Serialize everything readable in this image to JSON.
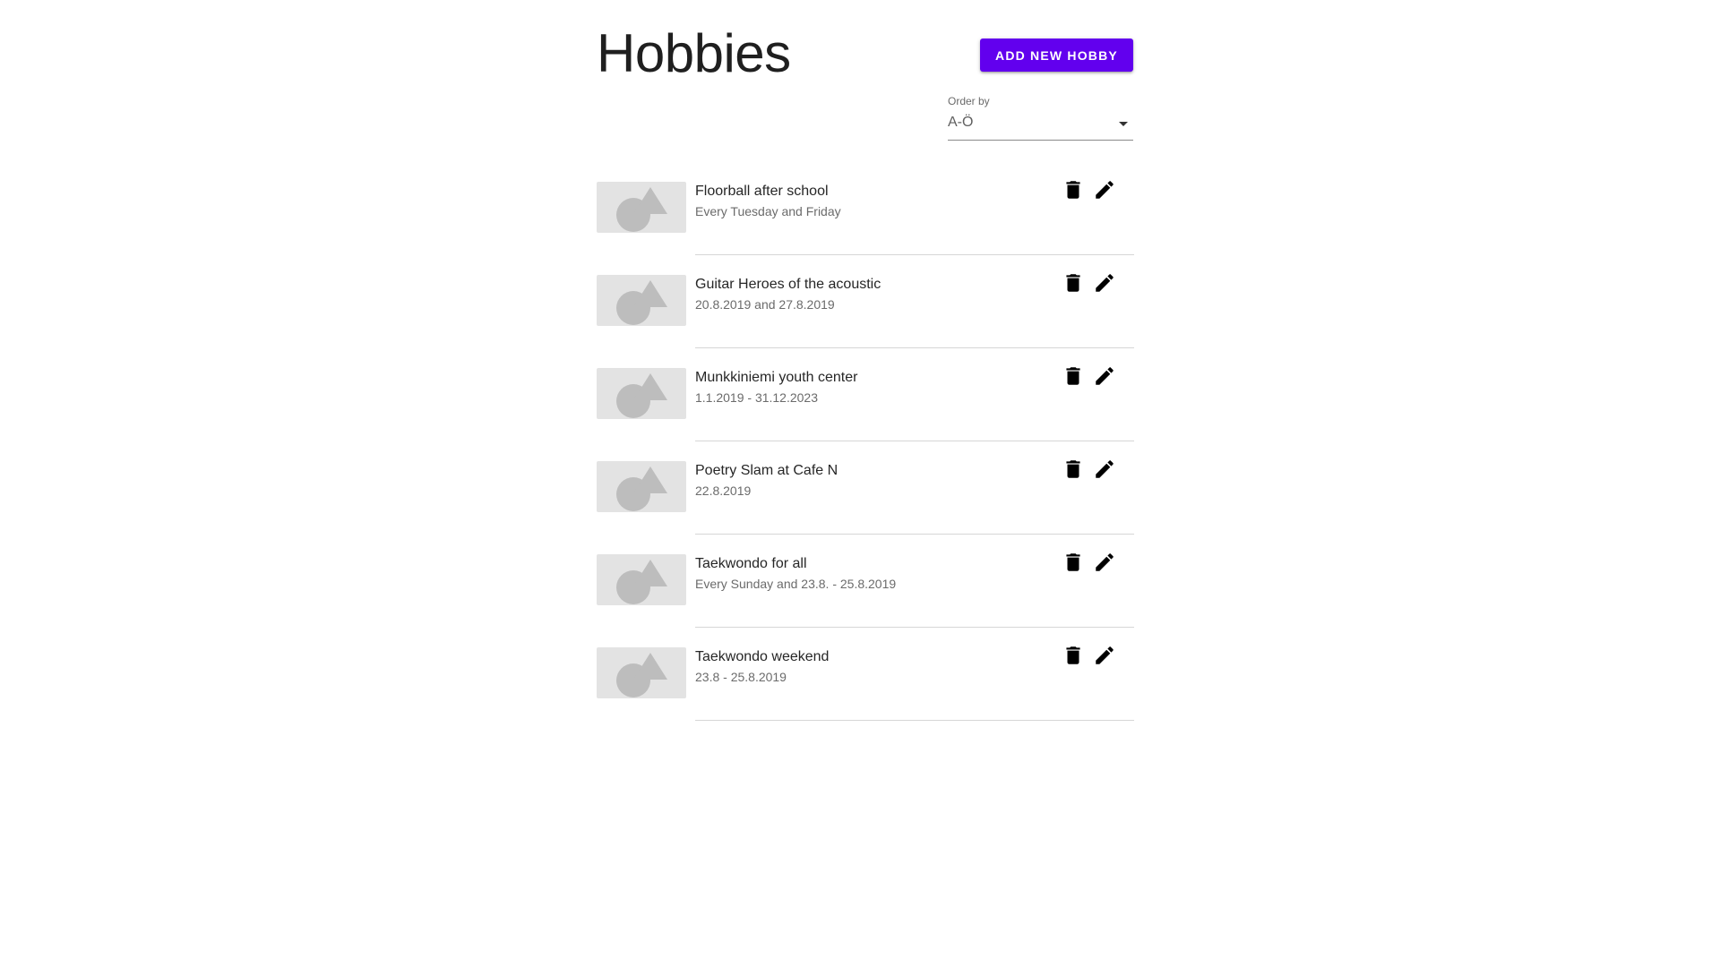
{
  "page": {
    "title": "Hobbies"
  },
  "toolbar": {
    "add_label": "ADD NEW HOBBY"
  },
  "order": {
    "label": "Order by",
    "value": "A-Ö"
  },
  "hobbies": [
    {
      "title": "Floorball after school",
      "subtitle": "Every Tuesday and Friday"
    },
    {
      "title": "Guitar Heroes of the acoustic",
      "subtitle": "20.8.2019 and 27.8.2019"
    },
    {
      "title": "Munkkiniemi youth center",
      "subtitle": "1.1.2019 - 31.12.2023"
    },
    {
      "title": "Poetry Slam at Cafe N",
      "subtitle": "22.8.2019"
    },
    {
      "title": "Taekwondo for all",
      "subtitle": "Every Sunday and 23.8. - 25.8.2019"
    },
    {
      "title": "Taekwondo weekend",
      "subtitle": "23.8 - 25.8.2019"
    }
  ],
  "icons": {
    "thumbnail": "image-placeholder-icon",
    "delete": "trash-icon",
    "edit": "pencil-icon",
    "dropdown": "arrow-drop-down-icon"
  },
  "colors": {
    "accent": "#6200ee",
    "placeholder_bg": "#e3e3e3",
    "placeholder_shape": "#bdbdbd",
    "divider": "#d6d6d6"
  }
}
